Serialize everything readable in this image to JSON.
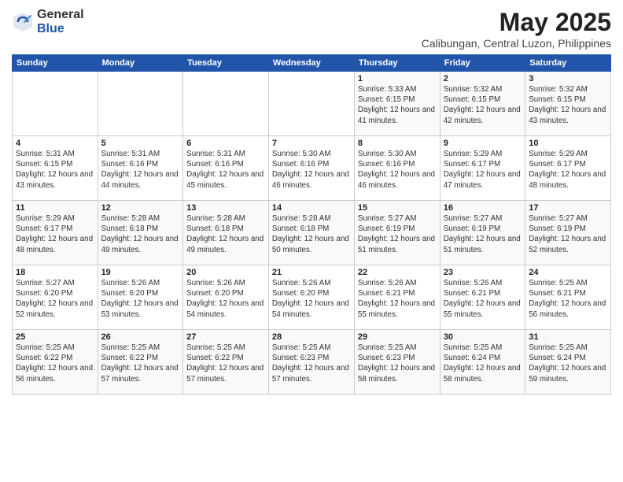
{
  "header": {
    "logo_general": "General",
    "logo_blue": "Blue",
    "month_title": "May 2025",
    "location": "Calibungan, Central Luzon, Philippines"
  },
  "days_of_week": [
    "Sunday",
    "Monday",
    "Tuesday",
    "Wednesday",
    "Thursday",
    "Friday",
    "Saturday"
  ],
  "weeks": [
    [
      {
        "day": "",
        "sunrise": "",
        "sunset": "",
        "daylight": ""
      },
      {
        "day": "",
        "sunrise": "",
        "sunset": "",
        "daylight": ""
      },
      {
        "day": "",
        "sunrise": "",
        "sunset": "",
        "daylight": ""
      },
      {
        "day": "",
        "sunrise": "",
        "sunset": "",
        "daylight": ""
      },
      {
        "day": "1",
        "sunrise": "5:33 AM",
        "sunset": "6:15 PM",
        "daylight": "12 hours and 41 minutes."
      },
      {
        "day": "2",
        "sunrise": "5:32 AM",
        "sunset": "6:15 PM",
        "daylight": "12 hours and 42 minutes."
      },
      {
        "day": "3",
        "sunrise": "5:32 AM",
        "sunset": "6:15 PM",
        "daylight": "12 hours and 43 minutes."
      }
    ],
    [
      {
        "day": "4",
        "sunrise": "5:31 AM",
        "sunset": "6:15 PM",
        "daylight": "12 hours and 43 minutes."
      },
      {
        "day": "5",
        "sunrise": "5:31 AM",
        "sunset": "6:16 PM",
        "daylight": "12 hours and 44 minutes."
      },
      {
        "day": "6",
        "sunrise": "5:31 AM",
        "sunset": "6:16 PM",
        "daylight": "12 hours and 45 minutes."
      },
      {
        "day": "7",
        "sunrise": "5:30 AM",
        "sunset": "6:16 PM",
        "daylight": "12 hours and 46 minutes."
      },
      {
        "day": "8",
        "sunrise": "5:30 AM",
        "sunset": "6:16 PM",
        "daylight": "12 hours and 46 minutes."
      },
      {
        "day": "9",
        "sunrise": "5:29 AM",
        "sunset": "6:17 PM",
        "daylight": "12 hours and 47 minutes."
      },
      {
        "day": "10",
        "sunrise": "5:29 AM",
        "sunset": "6:17 PM",
        "daylight": "12 hours and 48 minutes."
      }
    ],
    [
      {
        "day": "11",
        "sunrise": "5:29 AM",
        "sunset": "6:17 PM",
        "daylight": "12 hours and 48 minutes."
      },
      {
        "day": "12",
        "sunrise": "5:28 AM",
        "sunset": "6:18 PM",
        "daylight": "12 hours and 49 minutes."
      },
      {
        "day": "13",
        "sunrise": "5:28 AM",
        "sunset": "6:18 PM",
        "daylight": "12 hours and 49 minutes."
      },
      {
        "day": "14",
        "sunrise": "5:28 AM",
        "sunset": "6:18 PM",
        "daylight": "12 hours and 50 minutes."
      },
      {
        "day": "15",
        "sunrise": "5:27 AM",
        "sunset": "6:19 PM",
        "daylight": "12 hours and 51 minutes."
      },
      {
        "day": "16",
        "sunrise": "5:27 AM",
        "sunset": "6:19 PM",
        "daylight": "12 hours and 51 minutes."
      },
      {
        "day": "17",
        "sunrise": "5:27 AM",
        "sunset": "6:19 PM",
        "daylight": "12 hours and 52 minutes."
      }
    ],
    [
      {
        "day": "18",
        "sunrise": "5:27 AM",
        "sunset": "6:20 PM",
        "daylight": "12 hours and 52 minutes."
      },
      {
        "day": "19",
        "sunrise": "5:26 AM",
        "sunset": "6:20 PM",
        "daylight": "12 hours and 53 minutes."
      },
      {
        "day": "20",
        "sunrise": "5:26 AM",
        "sunset": "6:20 PM",
        "daylight": "12 hours and 54 minutes."
      },
      {
        "day": "21",
        "sunrise": "5:26 AM",
        "sunset": "6:20 PM",
        "daylight": "12 hours and 54 minutes."
      },
      {
        "day": "22",
        "sunrise": "5:26 AM",
        "sunset": "6:21 PM",
        "daylight": "12 hours and 55 minutes."
      },
      {
        "day": "23",
        "sunrise": "5:26 AM",
        "sunset": "6:21 PM",
        "daylight": "12 hours and 55 minutes."
      },
      {
        "day": "24",
        "sunrise": "5:25 AM",
        "sunset": "6:21 PM",
        "daylight": "12 hours and 56 minutes."
      }
    ],
    [
      {
        "day": "25",
        "sunrise": "5:25 AM",
        "sunset": "6:22 PM",
        "daylight": "12 hours and 56 minutes."
      },
      {
        "day": "26",
        "sunrise": "5:25 AM",
        "sunset": "6:22 PM",
        "daylight": "12 hours and 57 minutes."
      },
      {
        "day": "27",
        "sunrise": "5:25 AM",
        "sunset": "6:22 PM",
        "daylight": "12 hours and 57 minutes."
      },
      {
        "day": "28",
        "sunrise": "5:25 AM",
        "sunset": "6:23 PM",
        "daylight": "12 hours and 57 minutes."
      },
      {
        "day": "29",
        "sunrise": "5:25 AM",
        "sunset": "6:23 PM",
        "daylight": "12 hours and 58 minutes."
      },
      {
        "day": "30",
        "sunrise": "5:25 AM",
        "sunset": "6:24 PM",
        "daylight": "12 hours and 58 minutes."
      },
      {
        "day": "31",
        "sunrise": "5:25 AM",
        "sunset": "6:24 PM",
        "daylight": "12 hours and 59 minutes."
      }
    ]
  ]
}
